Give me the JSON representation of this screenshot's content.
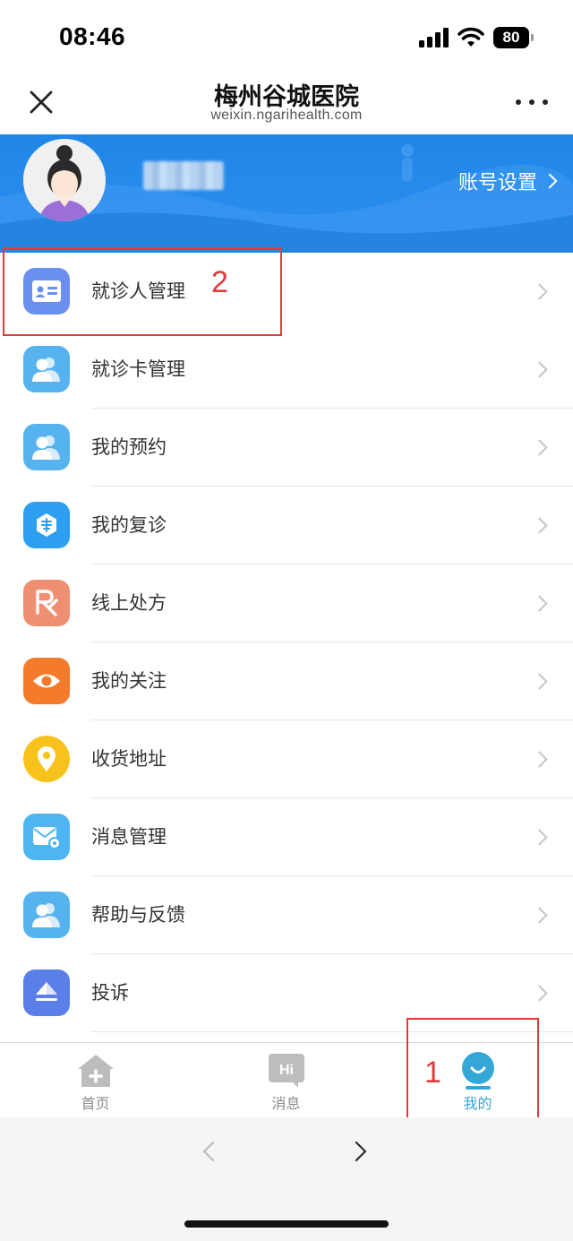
{
  "status_bar": {
    "time": "08:46",
    "battery": "80"
  },
  "nav": {
    "title": "梅州谷城医院",
    "subtitle": "weixin.ngarihealth.com"
  },
  "profile": {
    "account_settings": "账号设置"
  },
  "menu": [
    {
      "label": "就诊人管理",
      "icon": "patient-card-icon",
      "color": "#6b8ff0"
    },
    {
      "label": "就诊卡管理",
      "icon": "users-icon",
      "color": "#57b3f0"
    },
    {
      "label": "我的预约",
      "icon": "users-icon",
      "color": "#57b3f0"
    },
    {
      "label": "我的复诊",
      "icon": "revisit-icon",
      "color": "#2e9ef0"
    },
    {
      "label": "线上处方",
      "icon": "prescription-icon",
      "color": "#ef8f72"
    },
    {
      "label": "我的关注",
      "icon": "eye-icon",
      "color": "#f37b2b"
    },
    {
      "label": "收货地址",
      "icon": "location-pin-icon",
      "color": "#f7c21c"
    },
    {
      "label": "消息管理",
      "icon": "mail-icon",
      "color": "#4fb4f2"
    },
    {
      "label": "帮助与反馈",
      "icon": "users-icon",
      "color": "#57b3f0"
    },
    {
      "label": "投诉",
      "icon": "complaint-icon",
      "color": "#5b7fe8"
    }
  ],
  "annotations": {
    "first": "1",
    "second": "2"
  },
  "tabs": [
    {
      "label": "首页",
      "icon": "home-icon"
    },
    {
      "label": "消息",
      "icon": "message-icon",
      "icon_text": "Hi"
    },
    {
      "label": "我的",
      "icon": "smile-icon"
    }
  ],
  "colors": {
    "accent": "#35a7d6",
    "header_blue": "#1f86e8",
    "annotation_red": "#e23a3a"
  }
}
